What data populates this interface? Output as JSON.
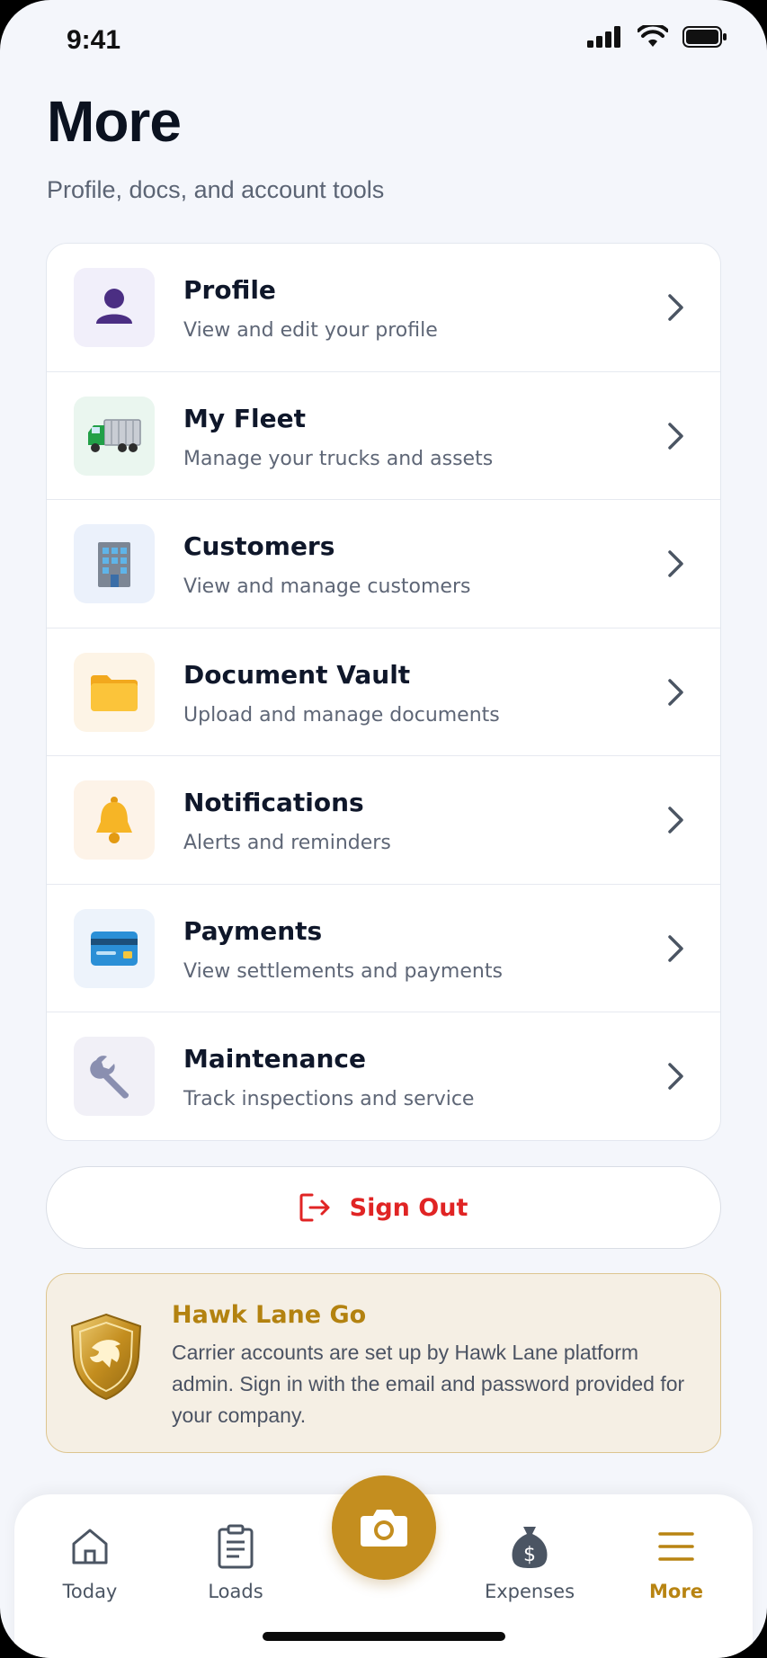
{
  "status_bar": {
    "time": "9:41"
  },
  "header": {
    "title": "More",
    "subtitle": "Profile, docs, and account tools"
  },
  "menu": [
    {
      "title": "Profile",
      "subtitle": "View and edit your profile",
      "icon": "person-icon",
      "icon_bg": "#f1effa"
    },
    {
      "title": "My Fleet",
      "subtitle": "Manage your trucks and assets",
      "icon": "truck-icon",
      "icon_bg": "#eaf6ef"
    },
    {
      "title": "Customers",
      "subtitle": "View and manage customers",
      "icon": "office-building-icon",
      "icon_bg": "#ebf1fb"
    },
    {
      "title": "Document Vault",
      "subtitle": "Upload and manage documents",
      "icon": "folder-icon",
      "icon_bg": "#fdf4e6"
    },
    {
      "title": "Notifications",
      "subtitle": "Alerts and reminders",
      "icon": "bell-icon",
      "icon_bg": "#fdf3e8"
    },
    {
      "title": "Payments",
      "subtitle": "View settlements and payments",
      "icon": "credit-card-icon",
      "icon_bg": "#edf3fb"
    },
    {
      "title": "Maintenance",
      "subtitle": "Track inspections and service",
      "icon": "wrench-icon",
      "icon_bg": "#f1f0f7"
    }
  ],
  "sign_out": {
    "label": "Sign Out",
    "color": "#e02424"
  },
  "info": {
    "title": "Hawk Lane Go",
    "body": "Carrier accounts are set up by Hawk Lane platform admin. Sign in with the email and password provided for your company."
  },
  "tabs": [
    {
      "label": "Today",
      "icon": "home-icon",
      "active": false
    },
    {
      "label": "Loads",
      "icon": "clipboard-icon",
      "active": false
    },
    {
      "label": "Expenses",
      "icon": "money-bag-icon",
      "active": false
    },
    {
      "label": "More",
      "icon": "menu-icon",
      "active": true
    }
  ],
  "camera": {
    "icon": "camera-icon"
  },
  "colors": {
    "accent": "#c48e1f",
    "background": "#f4f6fb"
  }
}
